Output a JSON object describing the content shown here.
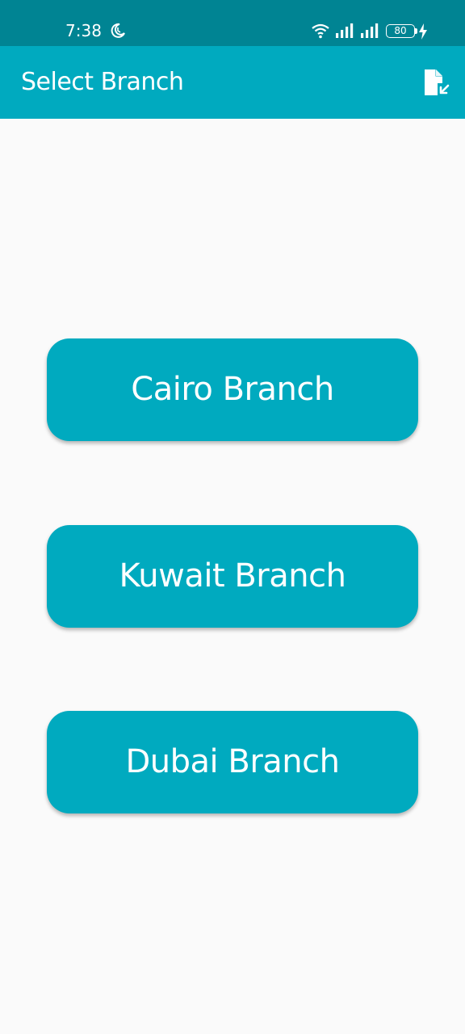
{
  "status_bar": {
    "time": "7:38",
    "battery": "80",
    "icons": [
      "moon-icon",
      "wifi-icon",
      "signal-icon",
      "signal-icon",
      "battery-icon",
      "charging-bolt-icon"
    ]
  },
  "app_bar": {
    "title": "Select Branch",
    "action_icon": "file-import-icon"
  },
  "branches": [
    {
      "label": "Cairo Branch"
    },
    {
      "label": "Kuwait Branch"
    },
    {
      "label": "Dubai Branch"
    }
  ],
  "colors": {
    "status_bar": "#008493",
    "primary": "#00aabf",
    "background": "#fafafa",
    "on_primary": "#ffffff"
  }
}
